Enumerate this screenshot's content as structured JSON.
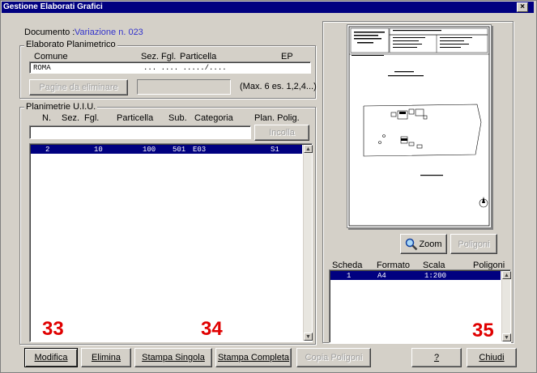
{
  "window": {
    "title": "Gestione Elaborati Grafici",
    "close": "×"
  },
  "documento": {
    "label": "Documento :",
    "value": "Variazione n. 023"
  },
  "elaborato": {
    "group_title": "Elaborato Planimetrico",
    "headers": {
      "comune": "Comune",
      "sez": "Sez.",
      "fgl": "Fgl.",
      "particella": "Particella",
      "ep": "EP"
    },
    "values": {
      "comune": "ROMA",
      "placeholder": "... .... ...../...."
    },
    "pagine_button": "Pagine da eliminare",
    "pagine_value": "",
    "max_hint": "(Max. 6  es. 1,2,4...)"
  },
  "planimetrie": {
    "group_title": "Planimetrie U.I.U.",
    "headers": {
      "n": "N.",
      "sez": "Sez.",
      "fgl": "Fgl.",
      "particella": "Particella",
      "sub": "Sub.",
      "categoria": "Categoria",
      "plan_polig": "Plan. Polig."
    },
    "input_value": "",
    "incolla": "Incolla",
    "rows": [
      {
        "n": "2",
        "sez": "",
        "fgl": "10",
        "particella": "100",
        "sub": "501",
        "categoria": "E03",
        "plan": "S1"
      }
    ]
  },
  "preview": {
    "zoom": "Zoom",
    "poligoni": "Poligoni",
    "headers": {
      "scheda": "Scheda",
      "formato": "Formato",
      "scala": "Scala",
      "poligoni": "Poligoni"
    },
    "rows": [
      {
        "scheda": "1",
        "formato": "A4",
        "scala": "1:200"
      }
    ],
    "doc": {
      "title1": "PIANO TERRA",
      "title2": "Impianto distribuzione carburanti"
    }
  },
  "markers": {
    "m1": "33",
    "m2": "34",
    "m3": "35"
  },
  "buttons": {
    "modifica": "Modifica",
    "elimina": "Elimina",
    "stampa_singola": "Stampa Singola",
    "stampa_completa": "Stampa Completa",
    "copia_poligoni": "Copia Poligoni",
    "help": "?",
    "chiudi": "Chiudi"
  },
  "colors": {
    "title_bar": "#000080",
    "link": "#3333cc",
    "marker": "#e00000",
    "selection": "#000080"
  }
}
